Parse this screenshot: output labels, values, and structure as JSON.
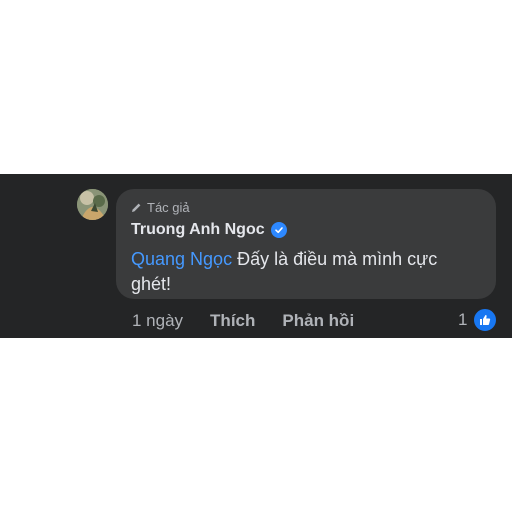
{
  "comment": {
    "author_badge": "Tác giả",
    "author_name": "Truong Anh Ngoc",
    "mention": "Quang Ngọc",
    "text": " Đấy là điều mà mình cực ghét!"
  },
  "actions": {
    "time": "1 ngày",
    "like_label": "Thích",
    "reply_label": "Phản hồi"
  },
  "reactions": {
    "count": "1",
    "icon": "like-reaction-icon"
  },
  "colors": {
    "background": "#242526",
    "bubble": "#3a3b3c",
    "mention": "#4599ff",
    "verified": "#2d88ff",
    "like": "#1877f2"
  }
}
